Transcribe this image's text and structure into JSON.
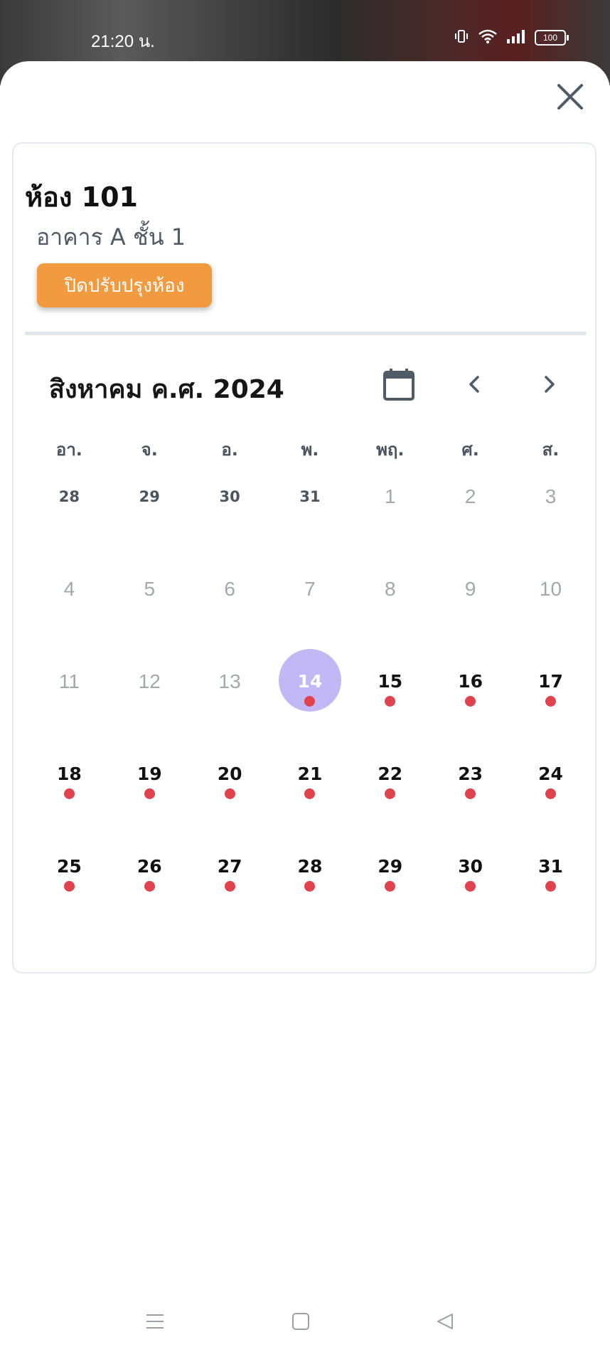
{
  "status_bar": {
    "time": "21:20 น.",
    "battery": "100"
  },
  "room": {
    "title": "ห้อง 101",
    "subtitle": "อาคาร A ชั้น 1",
    "maintenance_button": "ปิดปรับปรุงห้อง"
  },
  "calendar": {
    "month_label": "สิงหาคม ค.ศ. 2024",
    "weekdays": [
      "อา.",
      "จ.",
      "อ.",
      "พ.",
      "พฤ.",
      "ศ.",
      "ส."
    ],
    "weeks": [
      [
        {
          "n": "28",
          "s": "prev"
        },
        {
          "n": "29",
          "s": "prev"
        },
        {
          "n": "30",
          "s": "prev"
        },
        {
          "n": "31",
          "s": "prev"
        },
        {
          "n": "1",
          "s": "disabled"
        },
        {
          "n": "2",
          "s": "disabled"
        },
        {
          "n": "3",
          "s": "disabled"
        }
      ],
      [
        {
          "n": "4",
          "s": "disabled"
        },
        {
          "n": "5",
          "s": "disabled"
        },
        {
          "n": "6",
          "s": "disabled"
        },
        {
          "n": "7",
          "s": "disabled"
        },
        {
          "n": "8",
          "s": "disabled"
        },
        {
          "n": "9",
          "s": "disabled"
        },
        {
          "n": "10",
          "s": "disabled"
        }
      ],
      [
        {
          "n": "11",
          "s": "disabled"
        },
        {
          "n": "12",
          "s": "disabled"
        },
        {
          "n": "13",
          "s": "disabled"
        },
        {
          "n": "14",
          "s": "selected",
          "dot": true
        },
        {
          "n": "15",
          "s": "active",
          "dot": true
        },
        {
          "n": "16",
          "s": "active",
          "dot": true
        },
        {
          "n": "17",
          "s": "active",
          "dot": true
        }
      ],
      [
        {
          "n": "18",
          "s": "active",
          "dot": true
        },
        {
          "n": "19",
          "s": "active",
          "dot": true
        },
        {
          "n": "20",
          "s": "active",
          "dot": true
        },
        {
          "n": "21",
          "s": "active",
          "dot": true
        },
        {
          "n": "22",
          "s": "active",
          "dot": true
        },
        {
          "n": "23",
          "s": "active",
          "dot": true
        },
        {
          "n": "24",
          "s": "active",
          "dot": true
        }
      ],
      [
        {
          "n": "25",
          "s": "active",
          "dot": true
        },
        {
          "n": "26",
          "s": "active",
          "dot": true
        },
        {
          "n": "27",
          "s": "active",
          "dot": true
        },
        {
          "n": "28",
          "s": "active",
          "dot": true
        },
        {
          "n": "29",
          "s": "active",
          "dot": true
        },
        {
          "n": "30",
          "s": "active",
          "dot": true
        },
        {
          "n": "31",
          "s": "active",
          "dot": true
        }
      ]
    ]
  },
  "colors": {
    "accent_orange": "#f29a3f",
    "selected_day": "#c2b8f6",
    "event_dot": "#e0434d"
  },
  "icons": {
    "close": "close-icon",
    "calendar": "calendar-icon",
    "prev": "chevron-left-icon",
    "next": "chevron-right-icon"
  }
}
